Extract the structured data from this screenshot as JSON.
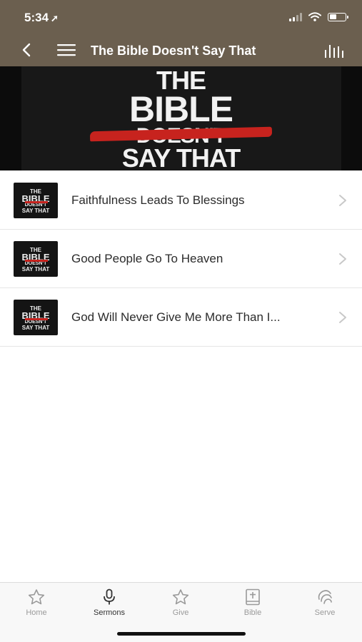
{
  "status": {
    "time": "5:34",
    "location_glyph": "➚"
  },
  "header": {
    "title": "The Bible Doesn't Say That"
  },
  "banner": {
    "line1": "THE",
    "line2": "BIBLE",
    "line3": "DOESN'T",
    "line4": "SAY THAT",
    "accent_color": "#c7231e"
  },
  "thumb": {
    "l1": "THE",
    "l2": "BIBLE",
    "l3": "DOESN'T",
    "l4": "SAY THAT"
  },
  "sermons": [
    {
      "title": "Faithfulness Leads To Blessings"
    },
    {
      "title": "Good People Go To Heaven"
    },
    {
      "title": "God Will Never Give Me More Than I..."
    }
  ],
  "tabs": [
    {
      "label": "Home",
      "icon": "star-icon",
      "active": false
    },
    {
      "label": "Sermons",
      "icon": "microphone-icon",
      "active": true
    },
    {
      "label": "Give",
      "icon": "star-icon",
      "active": false
    },
    {
      "label": "Bible",
      "icon": "bible-icon",
      "active": false
    },
    {
      "label": "Serve",
      "icon": "serve-icon",
      "active": false
    }
  ],
  "colors": {
    "header_bg": "#6b5f4f",
    "active_tab": "#333333",
    "inactive_tab": "#9a9a9a"
  }
}
